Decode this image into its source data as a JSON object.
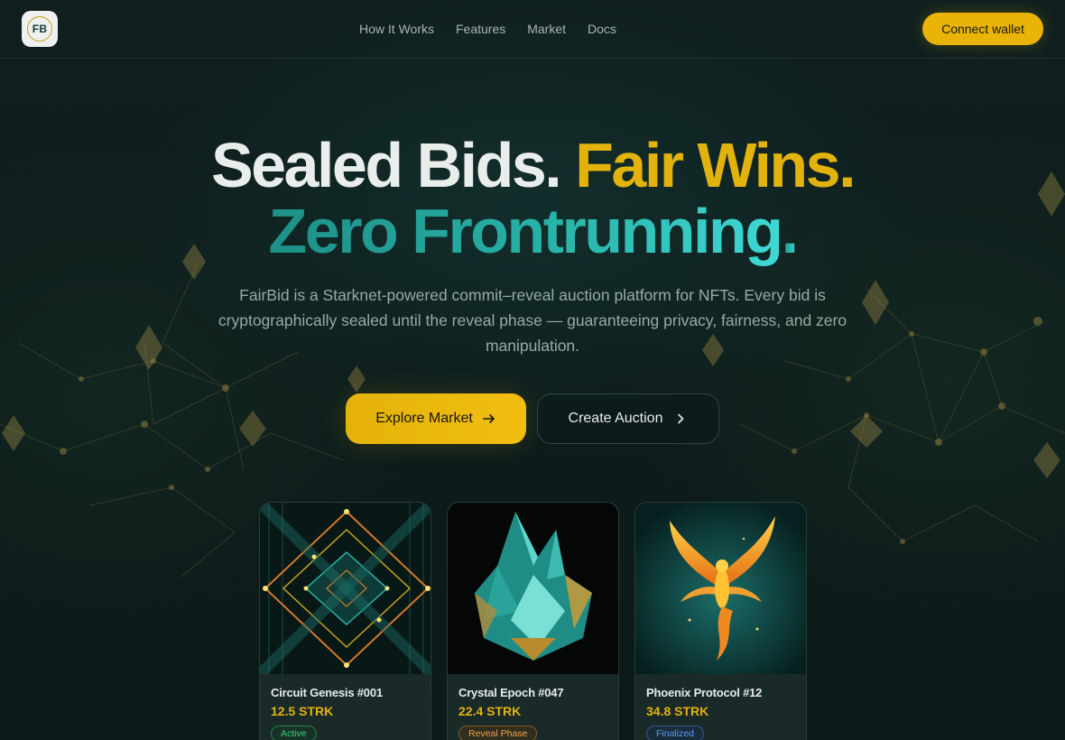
{
  "header": {
    "logo_text": "FB",
    "nav": [
      "How It Works",
      "Features",
      "Market",
      "Docs"
    ],
    "connect_label": "Connect wallet"
  },
  "hero": {
    "line1_a": "Sealed Bids",
    "line1_dot": ".",
    "line1_b": "Fair Wins",
    "line1_dot2": ".",
    "line2_a": "Zero Frontrunning",
    "line2_dot": ".",
    "subtitle": "FairBid is a Starknet-powered commit–reveal auction platform for NFTs. Every bid is cryptographically sealed until the reveal phase — guaranteeing privacy, fairness, and zero manipulation.",
    "explore_label": "Explore Market",
    "create_label": "Create Auction"
  },
  "cards": [
    {
      "title": "Circuit Genesis #001",
      "price": "12.5 STRK",
      "status": "Active"
    },
    {
      "title": "Crystal Epoch #047",
      "price": "22.4 STRK",
      "status": "Reveal Phase"
    },
    {
      "title": "Phoenix Protocol #12",
      "price": "34.8 STRK",
      "status": "Finalized"
    }
  ],
  "colors": {
    "accent": "#eab308",
    "background": "#0d1a1a",
    "teal": "#27b3a9",
    "active": "#3fcf72",
    "reveal": "#f0a54a",
    "finalized": "#5b9cf0"
  }
}
